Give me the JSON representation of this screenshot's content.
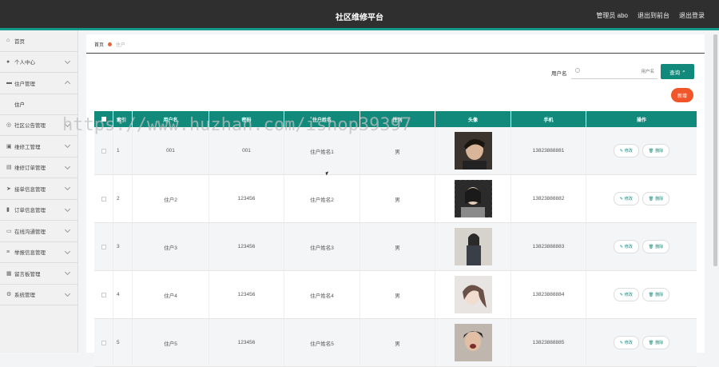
{
  "header": {
    "title": "社区维修平台",
    "admin": "管理员 abo",
    "back": "退出到前台",
    "logout": "退出登录"
  },
  "sidebar": {
    "items": [
      {
        "label": "首页",
        "icon": "home-icon",
        "glyph": "⌂"
      },
      {
        "label": "个人中心",
        "icon": "person-icon",
        "glyph": "●"
      },
      {
        "label": "住户管理",
        "icon": "monitor-icon",
        "glyph": "▬",
        "expanded": true
      },
      {
        "label": "社区公告管理",
        "icon": "info-icon",
        "glyph": "◎"
      },
      {
        "label": "维修工管理",
        "icon": "box-icon",
        "glyph": "▣"
      },
      {
        "label": "维修订单管理",
        "icon": "doc-icon",
        "glyph": "▤"
      },
      {
        "label": "接单信息管理",
        "icon": "send-icon",
        "glyph": "➤"
      },
      {
        "label": "订单信息管理",
        "icon": "chart-icon",
        "glyph": "▮"
      },
      {
        "label": "在线沟通管理",
        "icon": "chat-icon",
        "glyph": "▭"
      },
      {
        "label": "举报信息管理",
        "icon": "list-icon",
        "glyph": "≡"
      },
      {
        "label": "留言板管理",
        "icon": "grid-icon",
        "glyph": "▦"
      },
      {
        "label": "系统管理",
        "icon": "gear-icon",
        "glyph": "⚙"
      }
    ],
    "sub": "住户"
  },
  "breadcrumb": {
    "home": "首页",
    "current": "住户"
  },
  "search": {
    "label": "用户名",
    "placeholder": "用户名",
    "button": "查询"
  },
  "add_button": "新增",
  "table": {
    "headers": [
      "索引",
      "用户名",
      "密码",
      "住户姓名",
      "性别",
      "头像",
      "手机",
      "操作"
    ],
    "edit_label": "修改",
    "delete_label": "删除",
    "rows": [
      {
        "idx": "1",
        "user": "001",
        "pwd": "001",
        "name": "住户姓名1",
        "sex": "男",
        "phone": "13823888881"
      },
      {
        "idx": "2",
        "user": "住户2",
        "pwd": "123456",
        "name": "住户姓名2",
        "sex": "男",
        "phone": "13823888882"
      },
      {
        "idx": "3",
        "user": "住户3",
        "pwd": "123456",
        "name": "住户姓名3",
        "sex": "男",
        "phone": "13823888883"
      },
      {
        "idx": "4",
        "user": "住户4",
        "pwd": "123456",
        "name": "住户姓名4",
        "sex": "男",
        "phone": "13823888884"
      },
      {
        "idx": "5",
        "user": "住户5",
        "pwd": "123456",
        "name": "住户姓名5",
        "sex": "男",
        "phone": "13823888885"
      }
    ]
  },
  "watermark": "https://www.huzhan.com/ishop39397",
  "colors": {
    "accent": "#11897b",
    "topbar": "#2f2f2f",
    "danger": "#f0562a"
  }
}
